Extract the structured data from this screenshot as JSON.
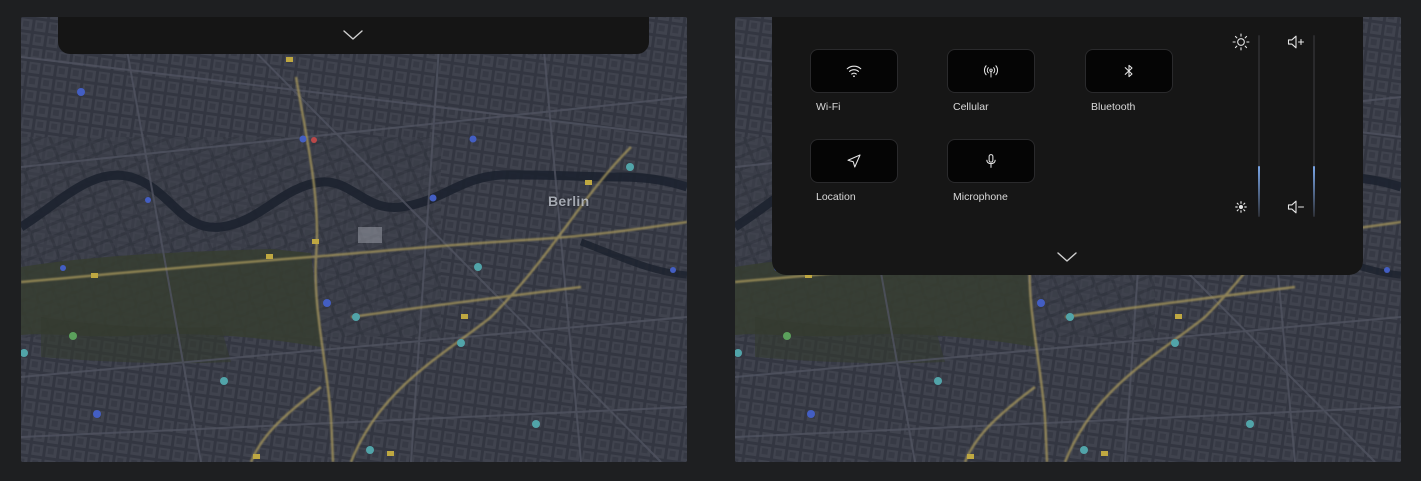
{
  "map": {
    "city_label": "Berlin"
  },
  "left_panel": {
    "expand_icon": "chevron-down-icon"
  },
  "control_panel": {
    "tiles": [
      {
        "label": "Wi-Fi",
        "icon": "wifi-icon"
      },
      {
        "label": "Cellular",
        "icon": "cellular-icon"
      },
      {
        "label": "Bluetooth",
        "icon": "bluetooth-icon"
      },
      {
        "label": "Location",
        "icon": "location-arrow-icon"
      },
      {
        "label": "Microphone",
        "icon": "microphone-icon"
      }
    ],
    "brightness": {
      "icon_high": "brightness-high-icon",
      "icon_low": "brightness-low-icon",
      "level": 0.28
    },
    "volume": {
      "icon_up": "volume-up-icon",
      "icon_down": "volume-down-icon",
      "level": 0.28
    },
    "collapse_icon": "chevron-down-icon"
  },
  "colors": {
    "panel_bg": "#161616",
    "tile_bg": "#050505",
    "slider_fill": "#7aa6e8",
    "road_major": "#c9b56a"
  }
}
